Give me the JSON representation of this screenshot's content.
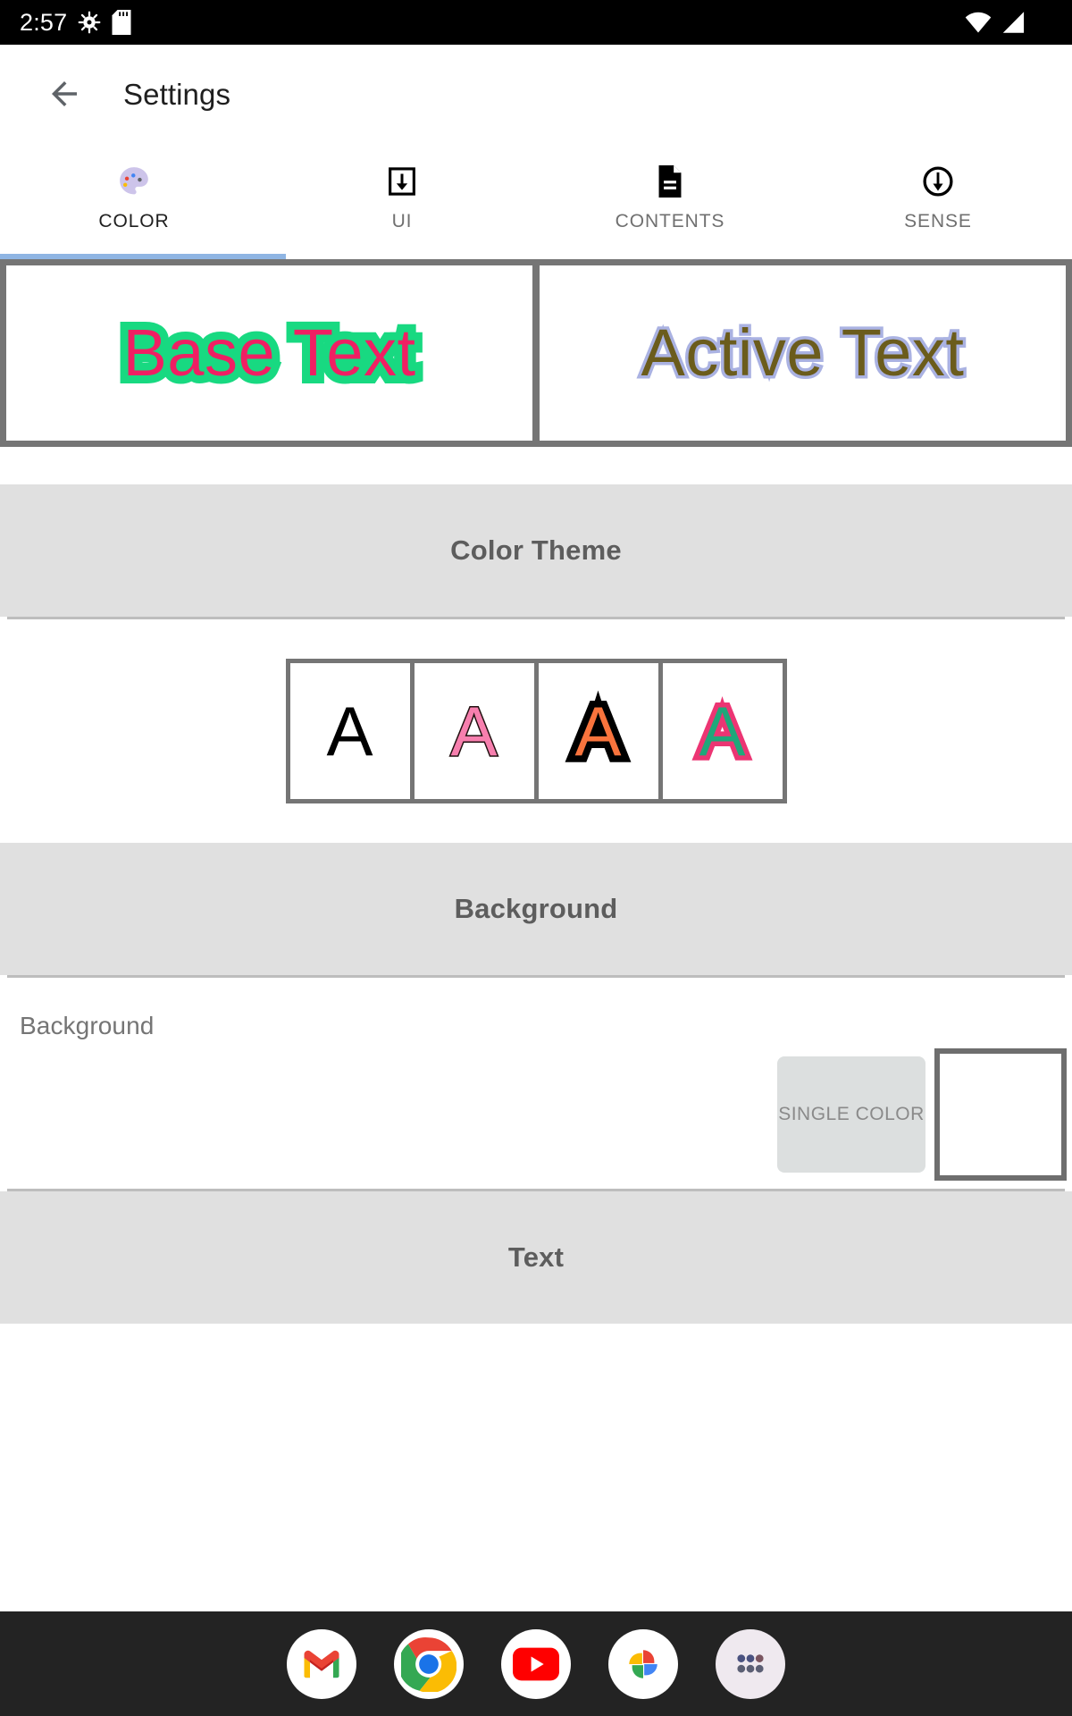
{
  "status_bar": {
    "clock": "2:57",
    "left_icons": [
      "bug-gear-icon",
      "sd-card-icon"
    ],
    "right_icons": [
      "wifi-icon",
      "signal-icon"
    ]
  },
  "appbar": {
    "back_icon": "arrow-back-icon",
    "title": "Settings"
  },
  "tabs": [
    {
      "label": "COLOR",
      "icon": "palette-icon",
      "active": true
    },
    {
      "label": "UI",
      "icon": "download-box-icon",
      "active": false
    },
    {
      "label": "CONTENTS",
      "icon": "document-icon",
      "active": false
    },
    {
      "label": "SENSE",
      "icon": "circle-down-arrow-icon",
      "active": false
    }
  ],
  "preview": {
    "base": {
      "text": "Base Text",
      "fill_color": "#f01f63",
      "stroke_color": "#18d981"
    },
    "active": {
      "text": "Active Text",
      "fill_color": "#6b5c1c",
      "stroke_color": "#aab2e2"
    }
  },
  "sections": {
    "color_theme": {
      "title": "Color Theme",
      "swatches": [
        {
          "glyph": "A",
          "fill": "#000000",
          "stroke": "#000000"
        },
        {
          "glyph": "A",
          "fill": "#f77fae",
          "stroke": "#221111"
        },
        {
          "glyph": "A",
          "fill": "#f9743d",
          "stroke": "#000000"
        },
        {
          "glyph": "A",
          "fill": "#1fa87a",
          "stroke": "#ec3573"
        }
      ]
    },
    "background": {
      "title": "Background",
      "option_label": "Background",
      "mode_button_label": "SINGLE COLOR",
      "swatch_color": "#ffffff"
    },
    "text": {
      "title": "Text"
    }
  },
  "dock": {
    "items": [
      {
        "name": "gmail-icon"
      },
      {
        "name": "chrome-icon"
      },
      {
        "name": "youtube-icon"
      },
      {
        "name": "google-photos-icon"
      },
      {
        "name": "app-drawer-icon"
      }
    ]
  },
  "colors": {
    "section_band": "#e0e0e0",
    "tab_indicator": "#8fb5e3",
    "border_gray": "#757575",
    "dock_bg": "#232323"
  }
}
